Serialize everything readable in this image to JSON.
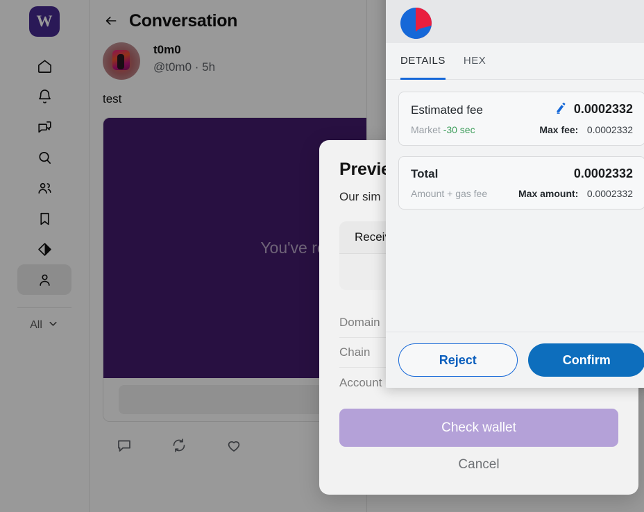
{
  "colors": {
    "brand_purple": "#472a91",
    "media_purple": "#431b6d",
    "cta_purple": "#b4a1d8",
    "wallet_blue": "#0d6ebd",
    "wallet_link_blue": "#1668d8",
    "green_time": "#3f9e5c"
  },
  "sidebar": {
    "logo_label": "W",
    "items": [
      {
        "icon": "home-icon",
        "label": "Home"
      },
      {
        "icon": "bell-icon",
        "label": "Notifications"
      },
      {
        "icon": "chat-bubbles-icon",
        "label": "Messages"
      },
      {
        "icon": "search-icon",
        "label": "Search"
      },
      {
        "icon": "people-icon",
        "label": "Channels"
      },
      {
        "icon": "bookmark-icon",
        "label": "Bookmarks"
      },
      {
        "icon": "diamond-icon",
        "label": "Rewards"
      },
      {
        "icon": "person-icon",
        "label": "Profile"
      }
    ],
    "filter": {
      "label": "All",
      "icon": "chevron-down-icon"
    }
  },
  "conversation": {
    "back_icon": "back-arrow-icon",
    "title": "Conversation",
    "post": {
      "author_name": "t0m0",
      "author_handle": "@t0m0 · 5h",
      "text": "test",
      "media_text": "You've reached the",
      "actions": [
        {
          "icon": "comment-icon"
        },
        {
          "icon": "recast-icon"
        },
        {
          "icon": "heart-icon"
        }
      ]
    }
  },
  "preview_modal": {
    "title": "Preview",
    "subtitle": "Our sim",
    "receipt_head": "Receiv",
    "rows": [
      {
        "label": "Domain"
      },
      {
        "label": "Chain"
      },
      {
        "label": "Account"
      }
    ],
    "cta_label": "Check wallet",
    "cancel_label": "Cancel"
  },
  "wallet_popup": {
    "logo_icon": "metamask-circle-logo",
    "tabs": [
      {
        "label": "DETAILS",
        "active": true
      },
      {
        "label": "HEX",
        "active": false
      }
    ],
    "fee_card": {
      "label": "Estimated fee",
      "edit_icon": "pencil-icon",
      "value": "0.0002332",
      "speed_label": "Market",
      "speed_time": "-30 sec",
      "max_label": "Max fee:",
      "max_value": "0.0002332"
    },
    "total_card": {
      "label": "Total",
      "value": "0.0002332",
      "sub_label": "Amount + gas fee",
      "max_label": "Max amount:",
      "max_value": "0.0002332"
    },
    "buttons": {
      "reject": "Reject",
      "confirm": "Confirm"
    }
  }
}
